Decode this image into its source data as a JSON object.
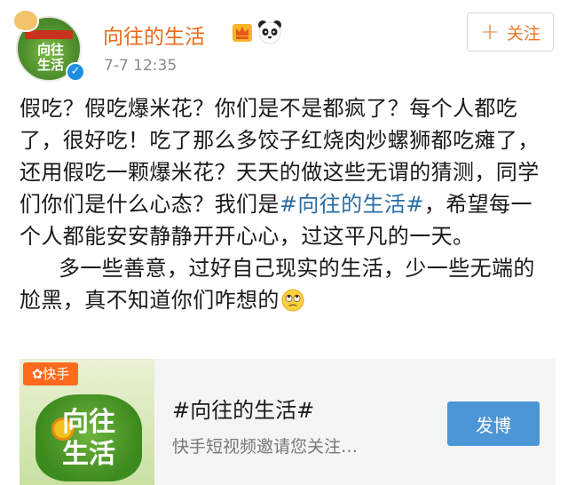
{
  "post": {
    "author": "向往的生活",
    "timestamp": "7-7 12:35",
    "follow_label": "关注",
    "avatar_text": "向往\n生活",
    "paragraph1_a": "假吃？假吃爆米花？你们是不是都疯了？每个人都吃了，很好吃！吃了那么多饺子红烧肉炒螺狮都吃瘫了，还用假吃一颗爆米花？天天的做这些无谓的猜测，同学们你们是什么心态？我们是",
    "paragraph1_hashtag": "#向往的生活#",
    "paragraph1_b": "，希望每一个人都能安安静静开开心心，过这平凡的一天。",
    "paragraph2": "多一些善意，过好自己现实的生活，少一些无端的尬黑，真不知道你们咋想的",
    "icons": {
      "crown": "crown-badge-icon",
      "panda": "panda-emoji-icon",
      "eye_roll": "eye-roll-emoji-icon",
      "verified": "verified-badge-icon"
    }
  },
  "card": {
    "source_tag": "快手",
    "thumb_text": "向往\n生活",
    "title": "#向往的生活#",
    "subtitle": "快手短视频邀请您关注…",
    "button_label": "发博"
  },
  "colors": {
    "username": "#eb6a1a",
    "hashtag": "#2b6ca3",
    "follow": "#e97a2b",
    "publish_button": "#4c96d7",
    "kuaishou": "#ff6a1f"
  }
}
